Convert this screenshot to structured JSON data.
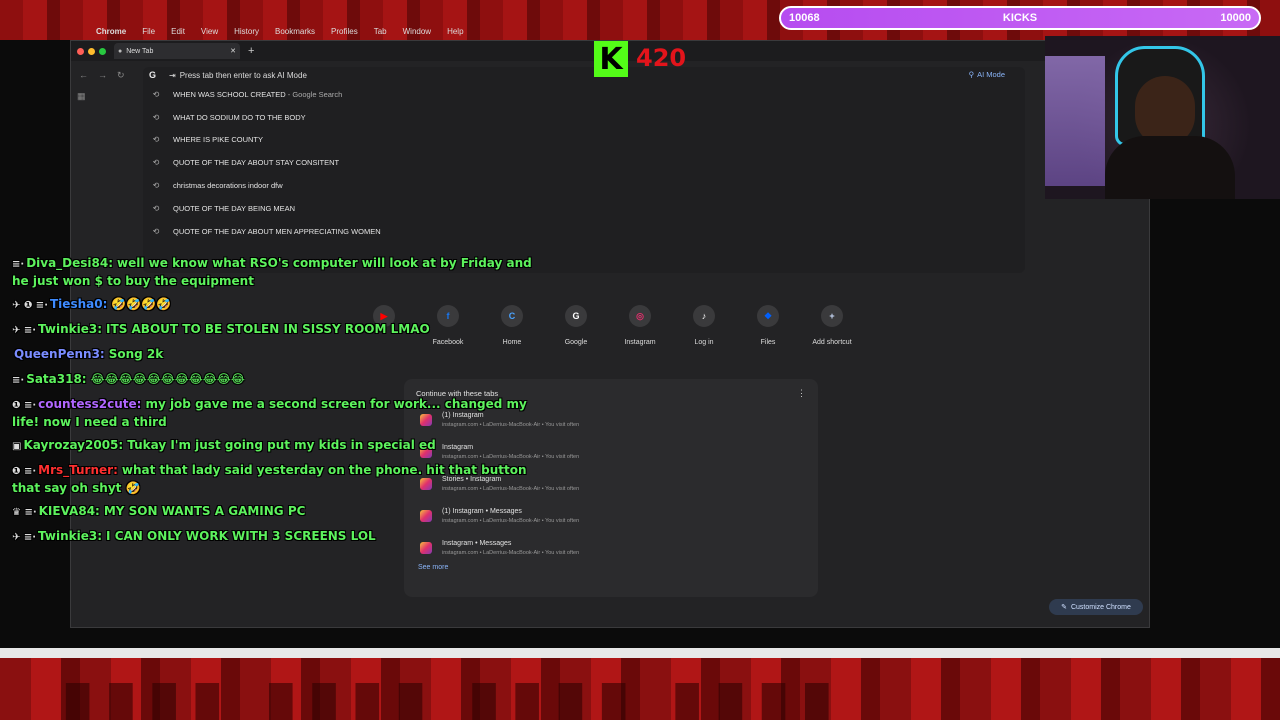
{
  "kicks_bar": {
    "left_value": "10068",
    "label": "KICKS",
    "right_value": "10000",
    "color": "#c261f4"
  },
  "kick_overlay": {
    "logo_letter": "K",
    "count": "420",
    "logo_color": "#53fc18",
    "count_color": "#e2141b"
  },
  "menubar": {
    "app": "Chrome",
    "items": [
      "File",
      "Edit",
      "View",
      "History",
      "Bookmarks",
      "Profiles",
      "Tab",
      "Window",
      "Help"
    ]
  },
  "browser": {
    "tab_title": "New Tab",
    "omnibox_hint": "Press tab then enter to ask AI Mode",
    "ai_mode_label": "AI Mode",
    "suggestions": [
      {
        "text": "WHEN WAS SCHOOL CREATED",
        "suffix": " - Google Search"
      },
      {
        "text": "WHAT DO SODIUM DO TO THE BODY",
        "suffix": ""
      },
      {
        "text": "WHERE IS PIKE COUNTY",
        "suffix": ""
      },
      {
        "text": "QUOTE OF THE DAY ABOUT STAY CONSITENT",
        "suffix": ""
      },
      {
        "text": "christmas decorations indoor dfw",
        "suffix": ""
      },
      {
        "text": "QUOTE OF THE DAY BEING MEAN",
        "suffix": ""
      },
      {
        "text": "QUOTE OF THE DAY ABOUT MEN APPRECIATING WOMEN",
        "suffix": ""
      }
    ],
    "shortcuts": [
      {
        "label": "",
        "icon": "youtube-icon",
        "glyph": "▶",
        "color": "#ff0000"
      },
      {
        "label": "Facebook",
        "icon": "facebook-icon",
        "glyph": "f",
        "color": "#1877f2"
      },
      {
        "label": "Home",
        "icon": "home-icon",
        "glyph": "C",
        "color": "#4aa3ff"
      },
      {
        "label": "Google",
        "icon": "google-icon",
        "glyph": "G",
        "color": "#ffffff"
      },
      {
        "label": "Instagram",
        "icon": "instagram-icon",
        "glyph": "◎",
        "color": "#e1306c"
      },
      {
        "label": "Log in",
        "icon": "tiktok-icon",
        "glyph": "♪",
        "color": "#ffffff"
      },
      {
        "label": "Files",
        "icon": "dropbox-icon",
        "glyph": "❖",
        "color": "#0061ff"
      },
      {
        "label": "Add shortcut",
        "icon": "plus-icon",
        "glyph": "+",
        "color": "#cfe0ff"
      }
    ],
    "continue_title": "Continue with these tabs",
    "continue_tabs": [
      {
        "title": "(1) Instagram",
        "meta": "instagram.com • LaDerrius-MacBook-Air • You visit often"
      },
      {
        "title": "Instagram",
        "meta": "instagram.com • LaDerrius-MacBook-Air • You visit often"
      },
      {
        "title": "Stories • Instagram",
        "meta": "instagram.com • LaDerrius-MacBook-Air • You visit often"
      },
      {
        "title": "(1) Instagram • Messages",
        "meta": "instagram.com • LaDerrius-MacBook-Air • You visit often"
      },
      {
        "title": "Instagram • Messages",
        "meta": "instagram.com • LaDerrius-MacBook-Air • You visit often"
      }
    ],
    "see_more": "See more",
    "customize": "Customize Chrome"
  },
  "chat": [
    {
      "user": "Diva_Desi84:",
      "text": "well we know what RSO's computer will look at by Friday and he just won $ to buy the equipment",
      "user_color": "#5df25d",
      "badges": "≡·"
    },
    {
      "user": "Tiesha0:",
      "text": "🤣🤣🤣🤣",
      "user_color": "#3e8bff",
      "badges": "✈ ❶ ≡·"
    },
    {
      "user": "Twinkie3:",
      "text": "ITS ABOUT TO BE STOLEN IN SISSY ROOM LMAO",
      "user_color": "#5df25d",
      "badges": "✈ ≡·"
    },
    {
      "user": "QueenPenn3:",
      "text": "Song 2k",
      "user_color": "#7a8cff",
      "badges": ""
    },
    {
      "user": "Sata318:",
      "text": "😂😂😂😂😂😂😂😂😂😂😂",
      "user_color": "#5df25d",
      "badges": "≡·"
    },
    {
      "user": "countess2cute:",
      "text": "my job gave me a second screen for work... changed my life! now I need a third",
      "user_color": "#b066ff",
      "badges": "❶ ≡·"
    },
    {
      "user": "Kayrozay2005:",
      "text": "Tukay I'm just going put my kids in   special ed",
      "user_color": "#5df25d",
      "badges": "▣"
    },
    {
      "user": "Mrs_Turner:",
      "text": "what that lady said yesterday on the phone. hit that button that say oh shyt 🤣",
      "user_color": "#ff3030",
      "badges": "❶ ≡·"
    },
    {
      "user": "KIEVA84:",
      "text": "MY SON WANTS A GAMING PC",
      "user_color": "#5df25d",
      "badges": "♛ ≡·"
    },
    {
      "user": "Twinkie3:",
      "text": "I CAN ONLY WORK WITH 3 SCREENS LOL",
      "user_color": "#5df25d",
      "badges": "✈ ≡·"
    }
  ]
}
